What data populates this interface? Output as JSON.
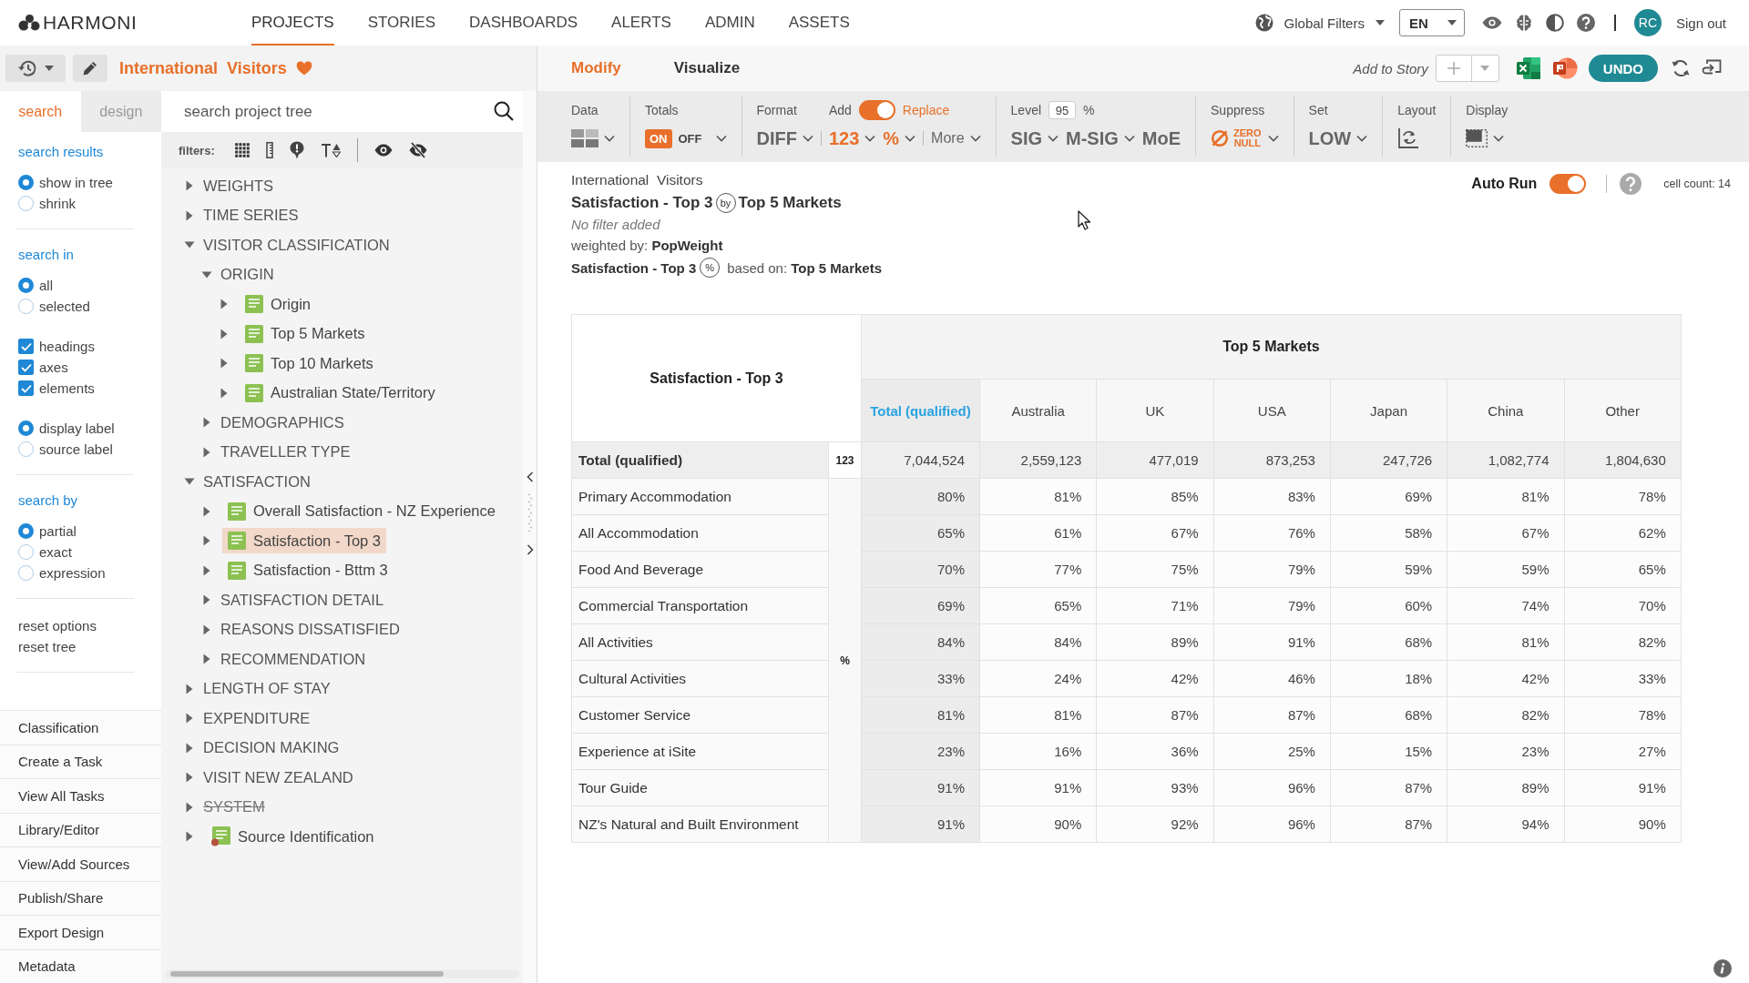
{
  "header": {
    "logo": "HARMONI",
    "nav": [
      {
        "label": "PROJECTS",
        "selected": true
      },
      {
        "label": "STORIES",
        "selected": false
      },
      {
        "label": "DASHBOARDS",
        "selected": false
      },
      {
        "label": "ALERTS",
        "selected": false
      },
      {
        "label": "ADMIN",
        "selected": false
      },
      {
        "label": "ASSETS",
        "selected": false
      }
    ],
    "global_filters": "Global Filters",
    "language": "EN",
    "avatar": "RC",
    "sign_out": "Sign out"
  },
  "project": {
    "title": "International  Visitors",
    "favorite": true
  },
  "side_tabs": [
    {
      "label": "search",
      "selected": true
    },
    {
      "label": "design",
      "selected": false
    }
  ],
  "tree_search": {
    "placeholder": "search project tree"
  },
  "filters_label": "filters:",
  "search_options": [
    {
      "heading": "search results",
      "groups": [
        {
          "kind": "radio",
          "options": [
            {
              "label": "show in tree",
              "selected": true
            },
            {
              "label": "shrink",
              "selected": false
            }
          ]
        }
      ]
    },
    {
      "heading": "search in",
      "groups": [
        {
          "kind": "radio",
          "options": [
            {
              "label": "all",
              "selected": true
            },
            {
              "label": "selected",
              "selected": false
            }
          ]
        },
        {
          "kind": "checkbox",
          "options": [
            {
              "label": "headings",
              "checked": true
            },
            {
              "label": "axes",
              "checked": true
            },
            {
              "label": "elements",
              "checked": true
            }
          ]
        },
        {
          "kind": "radio",
          "options": [
            {
              "label": "display label",
              "selected": true
            },
            {
              "label": "source label",
              "selected": false
            }
          ]
        }
      ]
    },
    {
      "heading": "search by",
      "groups": [
        {
          "kind": "radio",
          "options": [
            {
              "label": "partial",
              "selected": true
            },
            {
              "label": "exact",
              "selected": false
            },
            {
              "label": "expression",
              "selected": false
            }
          ]
        }
      ]
    }
  ],
  "reset_links": [
    "reset options",
    "reset tree"
  ],
  "side_nav": [
    "Classification",
    "Create a Task",
    "View All Tasks",
    "Library/Editor",
    "View/Add Sources",
    "Publish/Share",
    "Export Design",
    "Metadata"
  ],
  "tree": [
    {
      "label": "WEIGHTS",
      "kind": "folder",
      "expanded": false,
      "selected": false,
      "excluded": false
    },
    {
      "label": "TIME SERIES",
      "kind": "folder",
      "expanded": false,
      "selected": false,
      "excluded": false
    },
    {
      "label": "VISITOR CLASSIFICATION",
      "kind": "folder",
      "expanded": true,
      "selected": false,
      "excluded": false,
      "children": [
        {
          "label": "ORIGIN",
          "kind": "folder",
          "expanded": true,
          "selected": false,
          "children": [
            {
              "label": "Origin",
              "kind": "item",
              "expanded": false,
              "selected": false
            },
            {
              "label": "Top 5 Markets",
              "kind": "item",
              "expanded": false,
              "selected": false
            },
            {
              "label": "Top 10 Markets",
              "kind": "item",
              "expanded": false,
              "selected": false
            },
            {
              "label": "Australian State/Territory",
              "kind": "item",
              "expanded": false,
              "selected": false
            }
          ]
        },
        {
          "label": "DEMOGRAPHICS",
          "kind": "folder",
          "expanded": false,
          "selected": false
        },
        {
          "label": "TRAVELLER TYPE",
          "kind": "folder",
          "expanded": false,
          "selected": false
        }
      ]
    },
    {
      "label": "SATISFACTION",
      "kind": "folder",
      "expanded": true,
      "selected": false,
      "excluded": false,
      "children": [
        {
          "label": "Overall Satisfaction - NZ Experience",
          "kind": "item",
          "expanded": false,
          "selected": false
        },
        {
          "label": "Satisfaction - Top 3",
          "kind": "item",
          "expanded": false,
          "selected": true
        },
        {
          "label": "Satisfaction - Bttm 3",
          "kind": "item",
          "expanded": false,
          "selected": false
        },
        {
          "label": "SATISFACTION DETAIL",
          "kind": "folder",
          "expanded": false,
          "selected": false
        },
        {
          "label": "REASONS DISSATISFIED",
          "kind": "folder",
          "expanded": false,
          "selected": false
        },
        {
          "label": "RECOMMENDATION",
          "kind": "folder",
          "expanded": false,
          "selected": false
        }
      ]
    },
    {
      "label": "LENGTH OF STAY",
      "kind": "folder",
      "expanded": false,
      "selected": false,
      "excluded": false
    },
    {
      "label": "EXPENDITURE",
      "kind": "folder",
      "expanded": false,
      "selected": false,
      "excluded": false
    },
    {
      "label": "DECISION MAKING",
      "kind": "folder",
      "expanded": false,
      "selected": false,
      "excluded": false
    },
    {
      "label": "VISIT NEW ZEALAND",
      "kind": "folder",
      "expanded": false,
      "selected": false,
      "excluded": false
    },
    {
      "label": "SYSTEM",
      "kind": "folder",
      "expanded": false,
      "selected": false,
      "excluded": true
    },
    {
      "label": "Source Identification",
      "kind": "source",
      "expanded": false,
      "selected": false,
      "excluded": false
    }
  ],
  "main_tabs": [
    {
      "label": "Modify",
      "selected": true
    },
    {
      "label": "Visualize",
      "selected": false
    }
  ],
  "add_to_story": "Add to Story",
  "undo": "UNDO",
  "toolbar": {
    "data": {
      "label": "Data"
    },
    "totals": {
      "label": "Totals",
      "on_label": "ON",
      "off_label": "OFF",
      "on": true
    },
    "format": {
      "label": "Format",
      "value": "DIFF",
      "add_label": "Add",
      "replace_label": "Replace",
      "replace": true,
      "options": [
        {
          "label": "123",
          "active": true
        },
        {
          "label": "%",
          "active": true
        }
      ],
      "more": "More"
    },
    "level": {
      "label": "Level",
      "value": "95",
      "unit": "%",
      "tests": [
        {
          "label": "SIG",
          "active": false,
          "dropdown": true
        },
        {
          "label": "M-SIG",
          "active": false,
          "dropdown": true
        },
        {
          "label": "MoE",
          "active": false,
          "dropdown": false
        }
      ]
    },
    "suppress": {
      "label": "Suppress",
      "lines": [
        "ZERO",
        "NULL"
      ],
      "active": true
    },
    "set": {
      "label": "Set",
      "value": "LOW"
    },
    "layout": {
      "label": "Layout"
    },
    "display": {
      "label": "Display"
    }
  },
  "report": {
    "project": "International  Visitors",
    "title": {
      "rows": "Satisfaction - Top 3",
      "connector": "by",
      "columns": "Top 5 Markets"
    },
    "filter": "No filter added",
    "weighting": "weighted by: **PopWeight**",
    "base": {
      "variable": "Satisfaction - Top 3",
      "marker": "%",
      "text": "based on: **Top 5 Markets**"
    }
  },
  "auto_run": {
    "label": "Auto Run",
    "on": true
  },
  "cell_count": "cell count: 14",
  "table": {
    "corner": "Satisfaction - Top 3",
    "group": "Top 5 Markets",
    "columns": [
      {
        "label": "Total (qualified)",
        "kind": "total"
      },
      {
        "label": "Australia",
        "kind": "market"
      },
      {
        "label": "UK",
        "kind": "market"
      },
      {
        "label": "USA",
        "kind": "market"
      },
      {
        "label": "Japan",
        "kind": "market"
      },
      {
        "label": "China",
        "kind": "market"
      },
      {
        "label": "Other",
        "kind": "market"
      }
    ],
    "total_row": {
      "label": "Total (qualified)",
      "stat": "123",
      "values": [
        "7,044,524",
        "2,559,123",
        "477,019",
        "873,253",
        "247,726",
        "1,082,774",
        "1,804,630"
      ]
    },
    "stat": "%",
    "rows": [
      {
        "label": "Primary Accommodation",
        "values": [
          "80%",
          "81%",
          "85%",
          "83%",
          "69%",
          "81%",
          "78%"
        ]
      },
      {
        "label": "All Accommodation",
        "values": [
          "65%",
          "61%",
          "67%",
          "76%",
          "58%",
          "67%",
          "62%"
        ]
      },
      {
        "label": "Food And Beverage",
        "values": [
          "70%",
          "77%",
          "75%",
          "79%",
          "59%",
          "59%",
          "65%"
        ]
      },
      {
        "label": "Commercial Transportation",
        "values": [
          "69%",
          "65%",
          "71%",
          "79%",
          "60%",
          "74%",
          "70%"
        ]
      },
      {
        "label": "All Activities",
        "values": [
          "84%",
          "84%",
          "89%",
          "91%",
          "68%",
          "81%",
          "82%"
        ]
      },
      {
        "label": "Cultural Activities",
        "values": [
          "33%",
          "24%",
          "42%",
          "46%",
          "18%",
          "42%",
          "33%"
        ]
      },
      {
        "label": "Customer Service",
        "values": [
          "81%",
          "81%",
          "87%",
          "87%",
          "68%",
          "82%",
          "78%"
        ]
      },
      {
        "label": "Experience at iSite",
        "values": [
          "23%",
          "16%",
          "36%",
          "25%",
          "15%",
          "23%",
          "27%"
        ]
      },
      {
        "label": "Tour Guide",
        "values": [
          "91%",
          "91%",
          "93%",
          "96%",
          "87%",
          "89%",
          "91%"
        ]
      },
      {
        "label": "NZ's Natural and Built Environment",
        "values": [
          "91%",
          "90%",
          "92%",
          "96%",
          "87%",
          "94%",
          "90%"
        ]
      }
    ]
  }
}
